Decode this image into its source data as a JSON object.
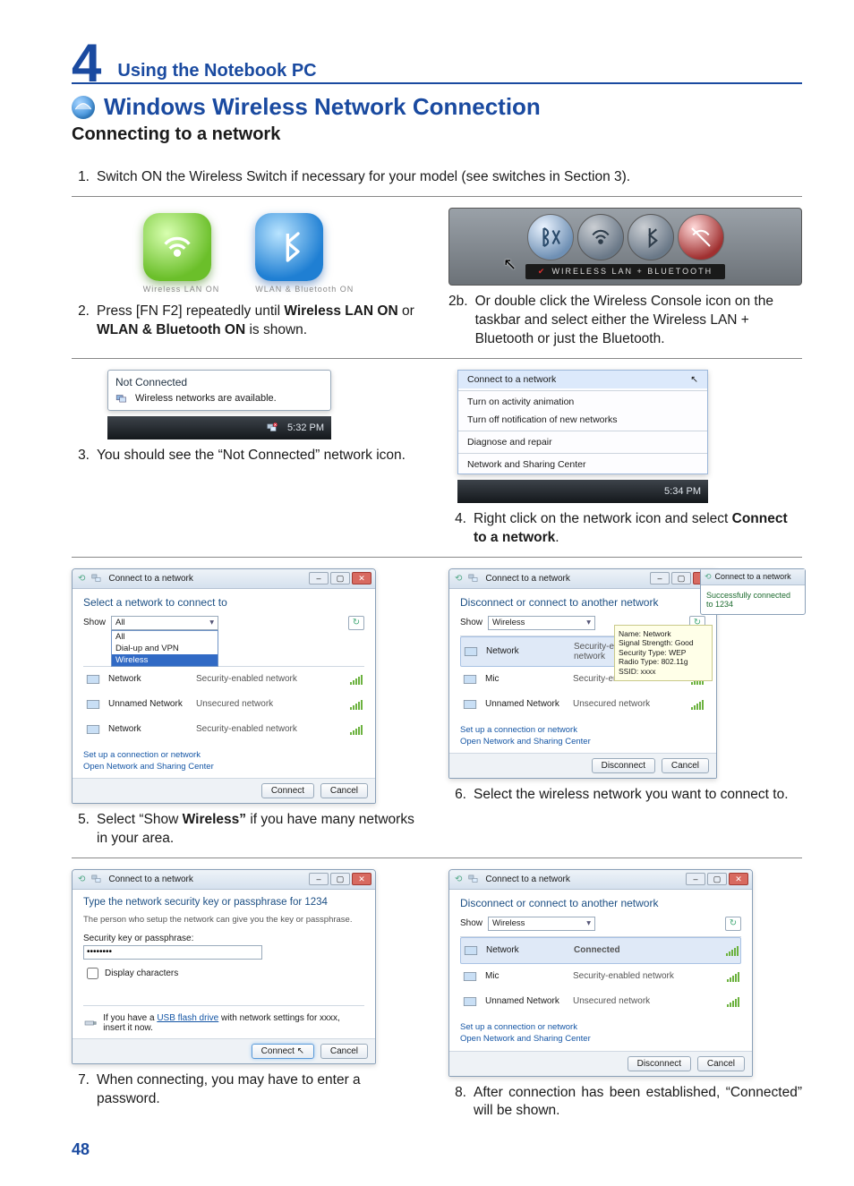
{
  "chapter": {
    "num": "4",
    "title": "Using the Notebook PC"
  },
  "title": "Windows Wireless Network Connection",
  "subtitle": "Connecting to a network",
  "page_number": "48",
  "steps": {
    "s1": "Switch ON the Wireless Switch if necessary for your model (see switches in Section 3).",
    "s2a_pre": "Press [FN F2] repeatedly until ",
    "s2a_b1": "Wireless LAN ON",
    "s2a_mid": " or ",
    "s2a_b2": "WLAN & Bluetooth ON",
    "s2a_post": " is shown.",
    "s2b": "Or double click the Wireless Console icon on the taskbar and select either the Wireless LAN + Bluetooth or just the Bluetooth.",
    "s3": "You should see the “Not Connected” network icon.",
    "s4_pre": "Right click on the network icon and select ",
    "s4_b": "Connect to a network",
    "s4_post": ".",
    "s5_pre": "Select “Show ",
    "s5_b": "Wireless”",
    "s5_post": " if you have many networks in your area.",
    "s6": "Select the wireless network you want to connect to.",
    "s7": "When connecting, you may have to enter a password.",
    "s8": "After connection has been established, “Connected” will be shown."
  },
  "icons2a": {
    "caption_left": "Wireless LAN ON",
    "caption_right": "WLAN & Bluetooth ON"
  },
  "toolbar2b": {
    "label": "Wireless LAN + Bluetooth"
  },
  "tray3": {
    "title": "Not Connected",
    "body": "Wireless networks are available.",
    "clock": "5:32 PM"
  },
  "ctx4": {
    "items": [
      "Connect to a network",
      "Turn on activity animation",
      "Turn off notification of new networks",
      "Diagnose and repair",
      "Network and Sharing Center"
    ],
    "clock": "5:34 PM"
  },
  "dlg_common": {
    "title": "Connect to a network",
    "links": [
      "Set up a connection or network",
      "Open Network and Sharing Center"
    ],
    "btn_connect": "Connect",
    "btn_cancel": "Cancel",
    "btn_disconnect": "Disconnect",
    "show_label": "Show"
  },
  "dlg5": {
    "header": "Select a network to connect to",
    "dd_value": "All",
    "dd_options": [
      "All",
      "Dial-up and VPN",
      "Wireless"
    ],
    "rows": [
      {
        "name": "Network",
        "type": "Security-enabled network"
      },
      {
        "name": "Unnamed Network",
        "type": "Unsecured network"
      },
      {
        "name": "Network",
        "type": "Security-enabled network"
      }
    ]
  },
  "dlg6": {
    "header": "Disconnect or connect to another network",
    "dd_value": "Wireless",
    "rows": [
      {
        "name": "Network",
        "type": "Security-enabled network"
      },
      {
        "name": "Mic",
        "type": "Security-enabled network"
      },
      {
        "name": "Unnamed Network",
        "type": "Unsecured network"
      }
    ],
    "side_msg": "Successfully connected to 1234",
    "tooltip": "Name: Network\nSignal Strength: Good\nSecurity Type: WEP\nRadio Type: 802.11g\nSSID: xxxx"
  },
  "dlg7": {
    "header": "Type the network security key or passphrase for 1234",
    "subtext": "The person who setup the network can give you the key or passphrase.",
    "field_label": "Security key or passphrase:",
    "field_value": "••••••••",
    "checkbox": "Display characters",
    "usb_pre": "If you have a ",
    "usb_link": "USB flash drive",
    "usb_post": " with network settings for xxxx, insert it now."
  },
  "dlg8": {
    "header": "Disconnect or connect to another network",
    "dd_value": "Wireless",
    "rows": [
      {
        "name": "Network",
        "type": "Connected",
        "bold": true
      },
      {
        "name": "Mic",
        "type": "Security-enabled network"
      },
      {
        "name": "Unnamed Network",
        "type": "Unsecured network"
      }
    ]
  }
}
